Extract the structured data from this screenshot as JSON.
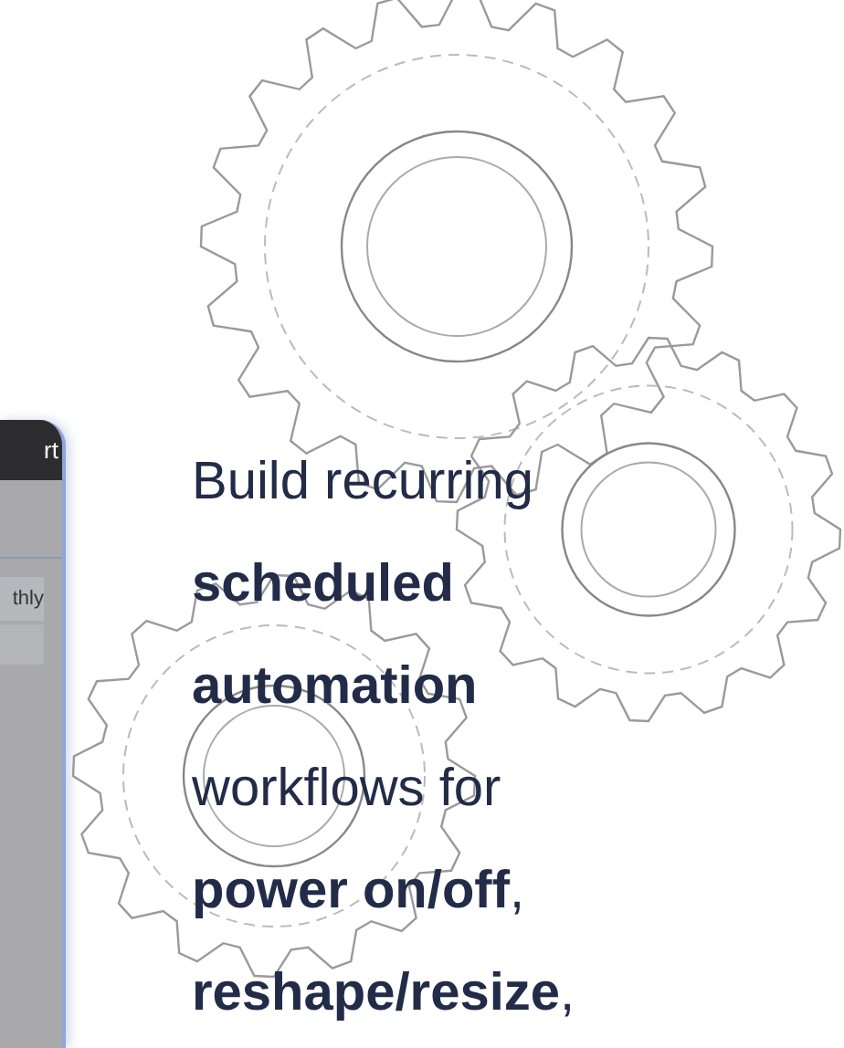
{
  "app_preview": {
    "header_text": "rt",
    "cell_text": "thly"
  },
  "headline": "Build recurring **scheduled automation** workflows for **power on/off**, **reshape/resize**,"
}
